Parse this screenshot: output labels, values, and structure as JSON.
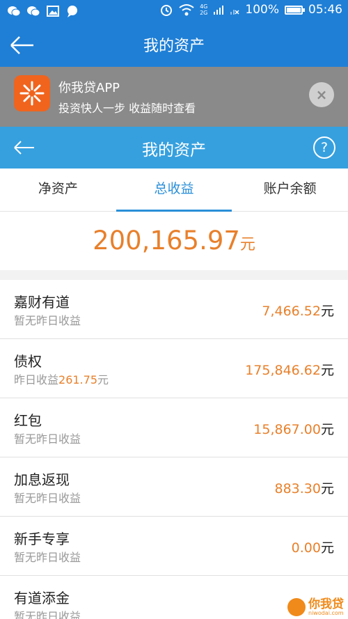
{
  "status_bar": {
    "battery": "100%",
    "battery_level": 1.0,
    "time": "05:46",
    "network_top": "4G",
    "network_bottom": "2G",
    "left_icons": [
      "wechat-icon",
      "wechat-icon",
      "image-icon",
      "chat-bubble-icon"
    ],
    "right_icons": [
      "alarm-icon",
      "wifi-icon",
      "signal-icon",
      "signal-icon",
      "battery-icon"
    ]
  },
  "app_bar": {
    "title": "我的资产"
  },
  "banner": {
    "title": "你我贷APP",
    "subtitle": "投资快人一步 收益随时查看",
    "close_label": "×"
  },
  "sub_header": {
    "title": "我的资产",
    "help_label": "?"
  },
  "tabs": [
    {
      "label": "净资产",
      "active": false
    },
    {
      "label": "总收益",
      "active": true
    },
    {
      "label": "账户余额",
      "active": false
    }
  ],
  "total": {
    "amount": "200,165.97",
    "unit": "元"
  },
  "items": [
    {
      "name": "嘉财有道",
      "sub": "暂无昨日收益",
      "sub_value": "",
      "sub_unit": "",
      "value": "7,466.52",
      "unit": "元"
    },
    {
      "name": "债权",
      "sub": "昨日收益",
      "sub_value": "261.75",
      "sub_unit": "元",
      "value": "175,846.62",
      "unit": "元"
    },
    {
      "name": "红包",
      "sub": "暂无昨日收益",
      "sub_value": "",
      "sub_unit": "",
      "value": "15,867.00",
      "unit": "元"
    },
    {
      "name": "加息返现",
      "sub": "暂无昨日收益",
      "sub_value": "",
      "sub_unit": "",
      "value": "883.30",
      "unit": "元"
    },
    {
      "name": "新手专享",
      "sub": "暂无昨日收益",
      "sub_value": "",
      "sub_unit": "",
      "value": "0.00",
      "unit": "元"
    },
    {
      "name": "有道添金",
      "sub": "暂无昨日收益",
      "sub_value": "",
      "sub_unit": "",
      "value": "",
      "unit": ""
    }
  ],
  "watermark": {
    "text": "你我贷",
    "url": "niwodai.com"
  },
  "colors": {
    "primary_blue": "#1f7fd6",
    "header_blue": "#36a0df",
    "tab_active": "#2a8fd8",
    "accent_orange": "#e8802b",
    "banner_gray": "#8a8a8a"
  }
}
